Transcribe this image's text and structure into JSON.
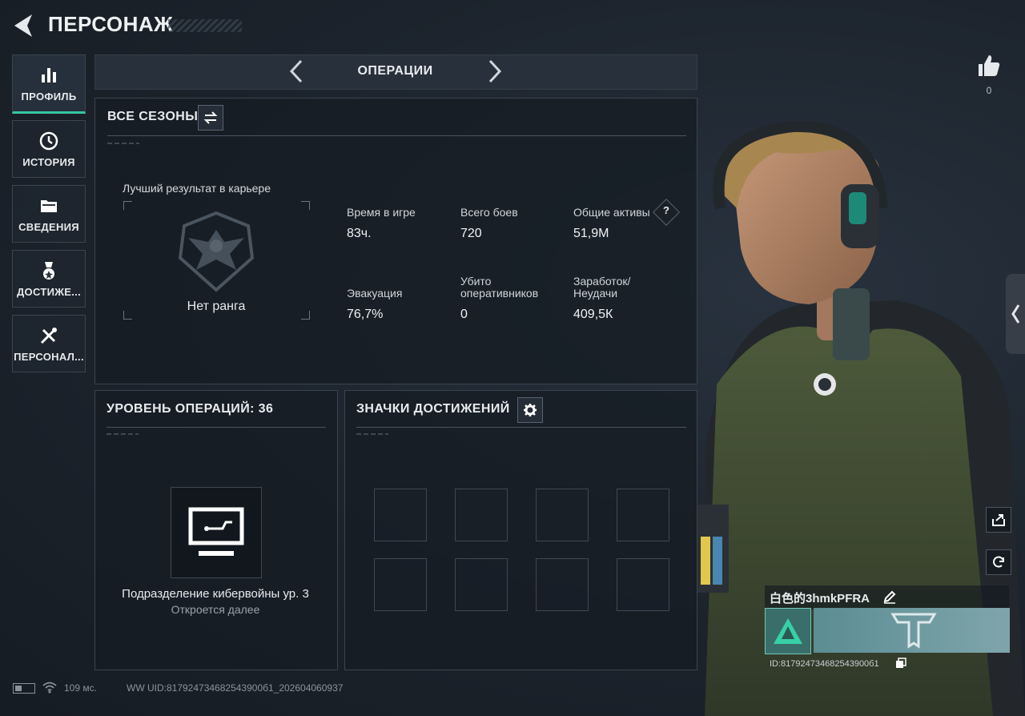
{
  "header": {
    "title": "ПЕРСОНАЖ"
  },
  "nav": [
    {
      "label": "ПРОФИЛЬ",
      "icon": "bar-chart-icon",
      "active": true
    },
    {
      "label": "ИСТОРИЯ",
      "icon": "history-icon"
    },
    {
      "label": "СВЕДЕНИЯ",
      "icon": "folder-icon"
    },
    {
      "label": "ДОСТИЖЕ...",
      "icon": "medal-icon"
    },
    {
      "label": "ПЕРСОНАЛ...",
      "icon": "tools-icon"
    }
  ],
  "mode": {
    "label": "ОПЕРАЦИИ"
  },
  "seasons": {
    "title": "ВСЕ СЕЗОНЫ",
    "best_label": "Лучший результат в карьере",
    "rank": "Нет ранга",
    "stats": [
      {
        "key": "Время в игре",
        "value": "83ч."
      },
      {
        "key": "Всего боев",
        "value": "720"
      },
      {
        "key": "Общие активы",
        "value": "51,9М",
        "help": "?"
      },
      {
        "key": "Эвакуация",
        "value": "76,7%"
      },
      {
        "key": "Убито оперативников",
        "value": "0"
      },
      {
        "key": "Заработок/ Неудачи",
        "value": "409,5К"
      }
    ]
  },
  "ops_level": {
    "title": "УРОВЕНЬ ОПЕРАЦИЙ: 36",
    "unit": "Подразделение кибервойны ур. 3",
    "unlock": "Откроется далее"
  },
  "achievements": {
    "title": "ЗНАЧКИ ДОСТИЖЕНИЙ"
  },
  "likes": {
    "count": "0"
  },
  "player": {
    "name": "白色的3hmkPFRA",
    "id": "ID:817924734682543900б1"
  },
  "footer": {
    "ping": "109 мс.",
    "uid": "WW UID:817924734682543900б1_202604060937"
  },
  "colors": {
    "accent": "#35c7a0",
    "panel": "#161c23"
  }
}
